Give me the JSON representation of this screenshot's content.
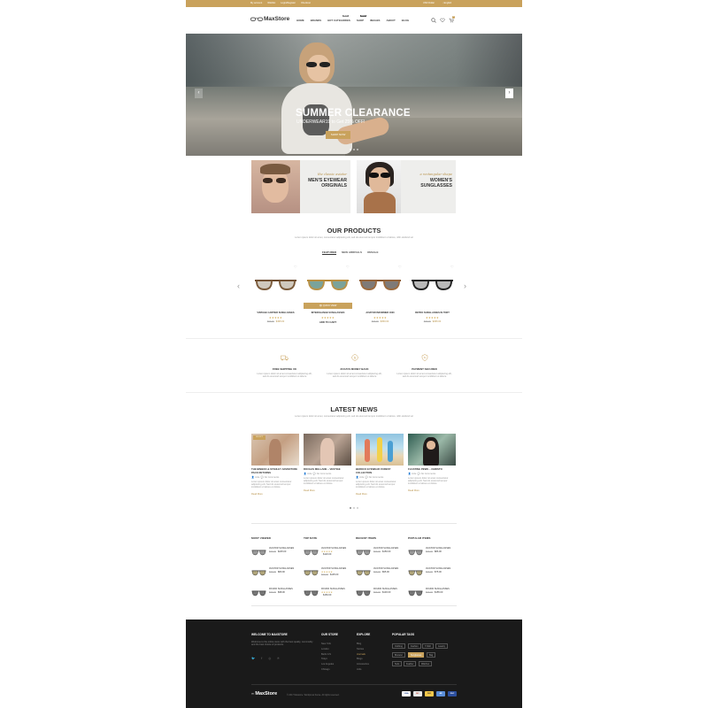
{
  "topbar": {
    "links": [
      "My account",
      "Wishlist",
      "Login/Register",
      "Checkout"
    ],
    "currency": "USD Dollar",
    "language": "English"
  },
  "header": {
    "logo": "MaxStore",
    "nav": [
      "HOME",
      "BRANDS",
      "HOT CATEGORIES",
      "SHOP",
      "IMAGES",
      "ABOUT",
      "BLOG"
    ],
    "badges": {
      "hot_categories": "NEW",
      "shop": "SALE"
    },
    "cart_count": "0"
  },
  "hero": {
    "title": "SUMMER CLEARANCE",
    "subtitle": "UNDERWEAR19 to Get 25% OFF!",
    "button": "SHOP NOW"
  },
  "promos": [
    {
      "script": "the classic aviator",
      "title": "MEN'S EYEWEAR ORIGINALS"
    },
    {
      "script": "a rectangular shape",
      "title": "WOMEN'S SUNGLASSES"
    }
  ],
  "products_section": {
    "title": "OUR PRODUCTS",
    "description": "Lorem ipsum dolor sit amet, consectetur adipiscing elit, sed do eiusmod tempor incididunt ut labore, nibh eleifend vel",
    "tabs": [
      "FEATURED",
      "NEW ARRIVALS",
      "ONSALE"
    ],
    "quick_view": "QUICK VIEW",
    "items": [
      {
        "name": "VINTAGE CARTIER SUNGLASSES",
        "old": "$99.00",
        "price": "$495.00",
        "stars": "★★★★★",
        "action": ""
      },
      {
        "name": "INTERCHANGE SUNGLASSES",
        "old": "",
        "price": "",
        "stars": "★★★★★",
        "action": "ADD TO CART"
      },
      {
        "name": "AVIATOR INFORMER 1600",
        "old": "$99.00",
        "price": "$350.00",
        "stars": "★★★★★",
        "action": ""
      },
      {
        "name": "RETRO SUNGLASSES IN TORT",
        "old": "$99.00",
        "price": "$295.00",
        "stars": "★★★★★",
        "action": ""
      }
    ]
  },
  "features": [
    {
      "title": "FREE SHIPPING UK",
      "text": "Lorem ipsum dolor sit amet consectetur adipiscing elit, sed do eiusmod tempor incididunt ut labore"
    },
    {
      "title": "30 DAYS MONEY BACK",
      "text": "Lorem ipsum dolor sit amet consectetur adipiscing elit, sed do eiusmod tempor incididunt ut labore"
    },
    {
      "title": "PAYMENT SECURED",
      "text": "Lorem ipsum dolor sit amet consectetur adipiscing elit, sed do eiusmod tempor incididunt ut labore"
    }
  ],
  "news": {
    "title": "LATEST NEWS",
    "description": "Lorem ipsum dolor sit amet, consectetur adipiscing elit, sed do eiusmod tempor incididunt ut labore, nibh eleifend vel",
    "date_badge": "03 OCT",
    "posts": [
      {
        "title": "THE BINBOO & STANLEY ADVENTURE PACK RETURNS",
        "meta1": "Jolie",
        "meta2": "No Comments",
        "text": "Lorem ipsum dolor sit amet consectetur adipiscing elit. Sed do eiusmod tempor incididunt ut labore et dolore",
        "more": "Read More"
      },
      {
        "title": "ROCHAS MELLANE – VESTIGE",
        "meta1": "Jolie",
        "meta2": "No Comments",
        "text": "Lorem ipsum dolor sit amet consectetur adipiscing elit. Sed do eiusmod tempor incididunt ut labore et dolore",
        "more": "Read More"
      },
      {
        "title": "BEROCO EYEWEAR FOREST COLLECTION",
        "meta1": "Jolie",
        "meta2": "No Comments",
        "text": "Lorem ipsum dolor sit amet consectetur adipiscing elit. Sed do eiusmod tempor incididunt ut labore et dolore",
        "more": "Read More"
      },
      {
        "title": "FLOATING PEWS – CHRISTO",
        "meta1": "Jolie",
        "meta2": "No Comments",
        "text": "Lorem ipsum dolor sit amet consectetur adipiscing elit. Sed do eiusmod tempor incididunt ut labore et dolore",
        "more": "Read More"
      }
    ]
  },
  "lists": [
    {
      "title": "MOST VIEWED",
      "items": [
        {
          "name": "AVIATOR SUNGLASSES",
          "old": "$99.00",
          "price": "$225.00",
          "stars": ""
        },
        {
          "name": "AVIATOR SUNGLASSES",
          "old": "$99.00",
          "price": "$80.00",
          "stars": ""
        },
        {
          "name": "ROUND SUNGLASSES",
          "old": "$99.00",
          "price": "$98.00",
          "stars": ""
        }
      ]
    },
    {
      "title": "TOP RATE",
      "items": [
        {
          "name": "AVIATOR SUNGLASSES",
          "old": "",
          "price": "$120.00",
          "stars": "★★★★★"
        },
        {
          "name": "AVIATOR SUNGLASSES",
          "old": "$99.00",
          "price": "$135.00",
          "stars": "★★★★★"
        },
        {
          "name": "ROUND SUNGLASSES",
          "old": "",
          "price": "$150.00",
          "stars": "★★★★★"
        }
      ]
    },
    {
      "title": "RECENT ITEMS",
      "items": [
        {
          "name": "AVIATOR SUNGLASSES",
          "old": "$99.00",
          "price": "$150.00",
          "stars": ""
        },
        {
          "name": "AVIATOR SUNGLASSES",
          "old": "$99.00",
          "price": "$95.00",
          "stars": ""
        },
        {
          "name": "ROUND SUNGLASSES",
          "old": "$99.00",
          "price": "$130.00",
          "stars": ""
        }
      ]
    },
    {
      "title": "POPULAR ITEMS",
      "items": [
        {
          "name": "AVIATOR SUNGLASSES",
          "old": "$99.00",
          "price": "$86.00",
          "stars": ""
        },
        {
          "name": "AVIATOR SUNGLASSES",
          "old": "$99.00",
          "price": "$75.00",
          "stars": ""
        },
        {
          "name": "ROUND SUNGLASSES",
          "old": "$99.00",
          "price": "$155.00",
          "stars": ""
        }
      ]
    }
  ],
  "footer": {
    "welcome_title": "WELCOME TO MAXSTORE",
    "welcome_text": "Welcome to the online store with the best quality, commodity and the best choice of products.",
    "store_title": "OUR STORE",
    "store_links": [
      "New York",
      "London",
      "Berlin US",
      "Tokyo",
      "Los Angeles",
      "Chicago"
    ],
    "explore_title": "EXPLORE",
    "explore_links": [
      "Blog",
      "Stories",
      "Journals",
      "Blogs",
      "Accessories",
      "Jobs"
    ],
    "tags_title": "POPULAR TAGS",
    "tags": [
      "Clothing",
      "Fashion",
      "T-Shirt",
      "Jewelry",
      "Bracelet",
      "Sunglasses",
      "Bag",
      "Suits",
      "Feather",
      "Watches"
    ],
    "logo": "MaxStore",
    "copyright": "© 2017 Maxstore. Wordpress theme. All rights reserved.",
    "payments": [
      "VISA",
      "MC",
      "PAY",
      "AE",
      "DSC"
    ]
  },
  "colors": {
    "accent": "#c9a25c",
    "footer_bg": "#1a1a1a"
  }
}
